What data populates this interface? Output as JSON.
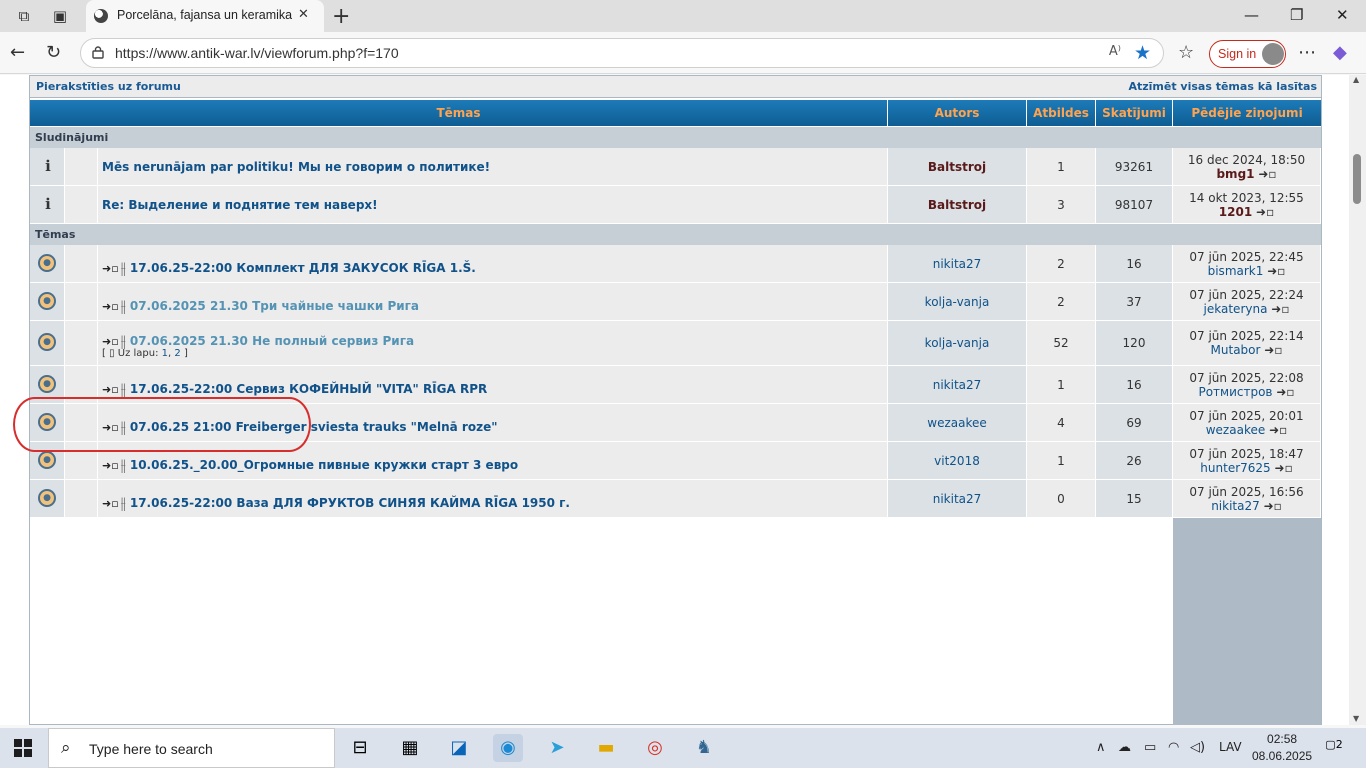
{
  "browser": {
    "tab_title": "Porcelāna, fajansa un keramikas iz",
    "url": "https://www.antik-war.lv/viewforum.php?f=170",
    "sign_in": "Sign in",
    "read_aloud": "A⁾"
  },
  "forum": {
    "login_link": "Pierakstīties uz forumu",
    "mark_read_link": "Atzīmēt visas tēmas kā lasītas",
    "headers": {
      "topics": "Tēmas",
      "author": "Autors",
      "replies": "Atbildes",
      "views": "Skatījumi",
      "last": "Pēdējie ziņojumi"
    },
    "cat_announcements": "Sludinājumi",
    "cat_topics": "Tēmas",
    "announcements": [
      {
        "title": "Mēs nerunājam par politiku! Мы не говорим о политике!",
        "author": "Baltstroj",
        "replies": "1",
        "views": "93261",
        "last_date": "16 dec 2024, 18:50",
        "last_user": "bmg1"
      },
      {
        "title": "Re: Выделение и поднятие тем наверх!",
        "author": "Baltstroj",
        "replies": "3",
        "views": "98107",
        "last_date": "14 okt 2023, 12:55",
        "last_user": "1201"
      }
    ],
    "topics": [
      {
        "title": "17.06.25-22:00 Комплект ДЛЯ ЗАКУСОК RĪGA 1.Š.",
        "author": "nikita27",
        "replies": "2",
        "views": "16",
        "last_date": "07 jūn 2025, 22:45",
        "last_user": "bismark1",
        "visited": false
      },
      {
        "title": "07.06.2025 21.30 Три чайные чашки Рига",
        "author": "kolja-vanja",
        "replies": "2",
        "views": "37",
        "last_date": "07 jūn 2025, 22:24",
        "last_user": "jekateryna",
        "visited": true
      },
      {
        "title": "07.06.2025 21.30 Не полный сервиз Рига",
        "author": "kolja-vanja",
        "replies": "52",
        "views": "120",
        "last_date": "07 jūn 2025, 22:14",
        "last_user": "Mutabor",
        "visited": true,
        "pages_label": "Uz lapu:",
        "pages": [
          "1",
          "2"
        ]
      },
      {
        "title": "17.06.25-22:00 Сервиз КОФЕЙНЫЙ \"VITA\" RĪGA RPR",
        "author": "nikita27",
        "replies": "1",
        "views": "16",
        "last_date": "07 jūn 2025, 22:08",
        "last_user": "Ротмистров",
        "visited": false
      },
      {
        "title": "07.06.25 21:00 Freiberger sviesta trauks \"Melnā roze\"",
        "author": "wezaakee",
        "replies": "4",
        "views": "69",
        "last_date": "07 jūn 2025, 20:01",
        "last_user": "wezaakee",
        "visited": false
      },
      {
        "title": "10.06.25._20.00_Огромные пивные кружки старт 3 евро",
        "author": "vit2018",
        "replies": "1",
        "views": "26",
        "last_date": "07 jūn 2025, 18:47",
        "last_user": "hunter7625",
        "visited": false
      },
      {
        "title": "17.06.25-22:00 Ваза ДЛЯ ФРУКТОВ СИНЯЯ КАЙМА RĪGA 1950 г.",
        "author": "nikita27",
        "replies": "0",
        "views": "15",
        "last_date": "07 jūn 2025, 16:56",
        "last_user": "nikita27",
        "visited": false
      }
    ]
  },
  "taskbar": {
    "search_placeholder": "Type here to search",
    "language": "LAV",
    "time": "02:58",
    "date": "08.06.2025",
    "notifications": "2"
  },
  "colors": {
    "header_blue": "#0e5d93",
    "header_text": "#ffa34f",
    "link": "#105289",
    "visited": "#5493b4",
    "annotation": "#d62d2d"
  }
}
